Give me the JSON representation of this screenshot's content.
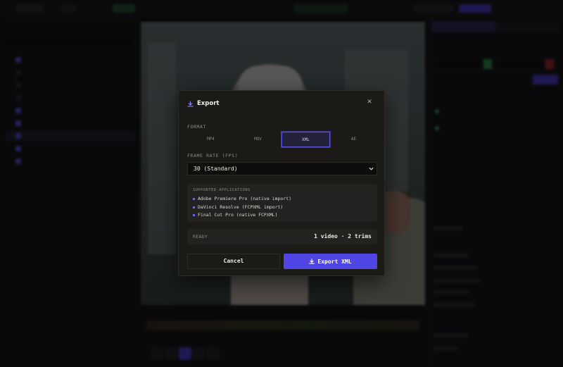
{
  "modal": {
    "title": "Export",
    "close_icon": "close-icon",
    "format_label": "FORMAT",
    "formats": [
      "MP4",
      "MOV",
      "XML",
      "AE"
    ],
    "selected_format": "XML",
    "frame_rate_label": "FRAME RATE (FPS)",
    "frame_rate_value": "30 (Standard)",
    "supported_apps_title": "SUPPORTED APPLICATIONS",
    "supported_apps": [
      "Adobe Premiere Pro (native import)",
      "DaVinci Resolve (FCPXML import)",
      "Final Cut Pro (native FCPXML)"
    ],
    "status": "READY",
    "summary": "1 video · 2 trims",
    "cancel_label": "Cancel",
    "export_label": "Export XML"
  },
  "colors": {
    "accent": "#5046e5",
    "modal_bg": "#1c1a17",
    "panel_bg": "#242220"
  }
}
